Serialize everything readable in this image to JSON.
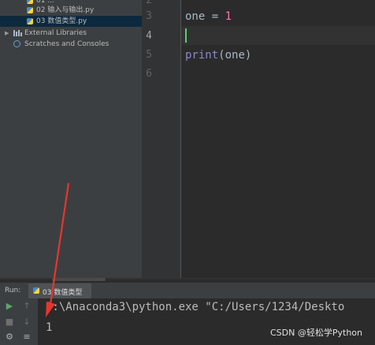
{
  "project_tree": {
    "items": [
      {
        "label": "01 ..."
      },
      {
        "label": "02 输入与输出.py"
      },
      {
        "label": "03 数值类型.py"
      },
      {
        "label": "External Libraries"
      },
      {
        "label": "Scratches and Consoles"
      }
    ]
  },
  "editor": {
    "line_numbers": [
      "2",
      "3",
      "4",
      "5",
      "6"
    ],
    "current_line": "4",
    "line3": {
      "var": "one",
      "op": " = ",
      "num": "1"
    },
    "line5": {
      "func": "print",
      "open": "(",
      "arg": "one",
      "close": ")"
    }
  },
  "run_panel": {
    "label": "Run:",
    "tab_label": "03 数值类型",
    "console_lines": [
      "D:\\Anaconda3\\python.exe \"C:/Users/1234/Deskto",
      "1"
    ]
  },
  "watermark": {
    "text": "CSDN @轻松学Python"
  },
  "colors": {
    "editor_bg": "#2b2b2b",
    "panel_bg": "#3c3f41",
    "selection": "#0d293e",
    "number": "#ff6fb4",
    "builtin": "#8888c6",
    "caret": "#58d16c",
    "annotation_arrow": "#e8352e"
  },
  "icons": [
    "python-file-icon",
    "library-icon",
    "scratches-icon",
    "run-icon",
    "stop-icon",
    "arrow-up-icon",
    "arrow-down-icon",
    "wrap-icon"
  ]
}
